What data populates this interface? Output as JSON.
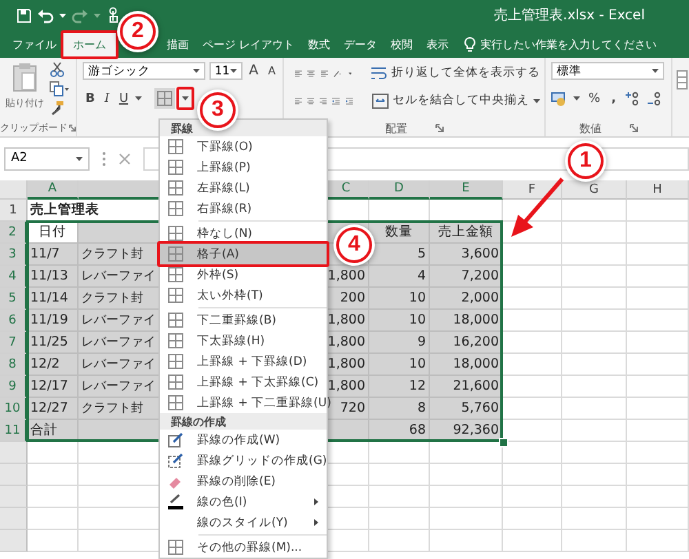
{
  "window": {
    "title": "売上管理表.xlsx  -  Excel"
  },
  "tabs": [
    {
      "label": "ファイル",
      "selected": false
    },
    {
      "label": "ホーム",
      "selected": true
    },
    {
      "label": "描画",
      "selected": false
    },
    {
      "label": "ページ レイアウト",
      "selected": false
    },
    {
      "label": "数式",
      "selected": false
    },
    {
      "label": "データ",
      "selected": false
    },
    {
      "label": "校閲",
      "selected": false
    },
    {
      "label": "表示",
      "selected": false
    }
  ],
  "tell_me": {
    "placeholder": "実行したい作業を入力してください"
  },
  "ribbon": {
    "clipboard": {
      "paste": "貼り付け",
      "label": "クリップボード"
    },
    "font": {
      "font_name": "游ゴシック",
      "font_size": "11",
      "grow": "A",
      "shrink": "A",
      "bold": "B",
      "italic": "I",
      "underline": "U"
    },
    "alignment": {
      "wrap": "折り返して全体を表示する",
      "merge": "セルを結合して中央揃え",
      "label": "配置"
    },
    "number": {
      "format": "標準",
      "percent": "%",
      "comma": ",",
      "label": "数値"
    }
  },
  "name_box": "A2",
  "sheet": {
    "columns": [
      {
        "label": "A",
        "selected": true
      },
      {
        "selected": true
      },
      {
        "label": "C",
        "selected": true
      },
      {
        "label": "D",
        "selected": true
      },
      {
        "label": "E",
        "selected": true
      },
      {
        "label": "F",
        "selected": false
      },
      {
        "label": "G",
        "selected": false
      },
      {
        "label": "H",
        "selected": false
      }
    ],
    "rows": [
      {
        "header": "1",
        "kind": "title",
        "selected": false,
        "cells": [
          "売上管理表"
        ]
      },
      {
        "header": "2",
        "kind": "heading",
        "selected": true,
        "cells": [
          "日付",
          null,
          null,
          "数量",
          "売上金額"
        ]
      },
      {
        "header": "3",
        "kind": "data",
        "selected": true,
        "cells": [
          "11/7",
          "クラフト封",
          null,
          "5",
          "3,600"
        ]
      },
      {
        "header": "4",
        "kind": "data",
        "selected": true,
        "cells": [
          "11/13",
          "レバーファイ",
          "1,800",
          "4",
          "7,200"
        ]
      },
      {
        "header": "5",
        "kind": "data",
        "selected": true,
        "cells": [
          "11/14",
          "クラフト封",
          "200",
          "10",
          "2,000"
        ]
      },
      {
        "header": "6",
        "kind": "data",
        "selected": true,
        "cells": [
          "11/19",
          "レバーファイ",
          "1,800",
          "10",
          "18,000"
        ]
      },
      {
        "header": "7",
        "kind": "data",
        "selected": true,
        "cells": [
          "11/25",
          "レバーファイ",
          "1,800",
          "9",
          "16,200"
        ]
      },
      {
        "header": "8",
        "kind": "data",
        "selected": true,
        "cells": [
          "12/2",
          "レバーファイ",
          "1,800",
          "10",
          "18,000"
        ]
      },
      {
        "header": "9",
        "kind": "data",
        "selected": true,
        "cells": [
          "12/17",
          "レバーファイ",
          "1,800",
          "12",
          "21,600"
        ]
      },
      {
        "header": "10",
        "kind": "data",
        "selected": true,
        "cells": [
          "12/27",
          "クラフト封",
          "720",
          "8",
          "5,760"
        ]
      },
      {
        "header": "11",
        "kind": "data",
        "selected": true,
        "cells": [
          "合計",
          null,
          null,
          "68",
          "92,360"
        ]
      }
    ]
  },
  "border_menu": {
    "sections": [
      {
        "title": "罫線",
        "groups": [
          [
            {
              "kind": "border",
              "label": "下罫線(O)",
              "selected": false,
              "submenu": false
            },
            {
              "kind": "border",
              "label": "上罫線(P)",
              "selected": false,
              "submenu": false
            },
            {
              "kind": "border",
              "label": "左罫線(L)",
              "selected": false,
              "submenu": false
            },
            {
              "kind": "border",
              "label": "右罫線(R)",
              "selected": false,
              "submenu": false
            }
          ],
          [
            {
              "kind": "border",
              "label": "枠なし(N)",
              "selected": false,
              "submenu": false
            },
            {
              "kind": "border",
              "label": "格子(A)",
              "selected": true,
              "submenu": false
            },
            {
              "kind": "border",
              "label": "外枠(S)",
              "selected": false,
              "submenu": false
            },
            {
              "kind": "border",
              "label": "太い外枠(T)",
              "selected": false,
              "submenu": false
            }
          ],
          [
            {
              "kind": "border",
              "label": "下二重罫線(B)",
              "selected": false,
              "submenu": false
            },
            {
              "kind": "border",
              "label": "下太罫線(H)",
              "selected": false,
              "submenu": false
            },
            {
              "kind": "border",
              "label": "上罫線 + 下罫線(D)",
              "selected": false,
              "submenu": false
            },
            {
              "kind": "border",
              "label": "上罫線 + 下太罫線(C)",
              "selected": false,
              "submenu": false
            },
            {
              "kind": "border",
              "label": "上罫線 + 下二重罫線(U)",
              "selected": false,
              "submenu": false
            }
          ]
        ]
      },
      {
        "title": "罫線の作成",
        "groups": [
          [
            {
              "kind": "draw",
              "label": "罫線の作成(W)",
              "selected": false,
              "submenu": false
            },
            {
              "kind": "drawgrid",
              "label": "罫線グリッドの作成(G)",
              "selected": false,
              "submenu": false
            },
            {
              "kind": "erase",
              "label": "罫線の削除(E)",
              "selected": false,
              "submenu": false
            },
            {
              "kind": "color",
              "label": "線の色(I)",
              "selected": false,
              "submenu": true
            },
            {
              "kind": "style",
              "label": "線のスタイル(Y)",
              "selected": false,
              "submenu": true
            }
          ],
          [
            {
              "kind": "border",
              "label": "その他の罫線(M)...",
              "selected": false,
              "submenu": false
            }
          ]
        ]
      }
    ]
  },
  "annotations": [
    {
      "label": "1"
    },
    {
      "label": "2"
    },
    {
      "label": "3"
    },
    {
      "label": "4"
    }
  ]
}
